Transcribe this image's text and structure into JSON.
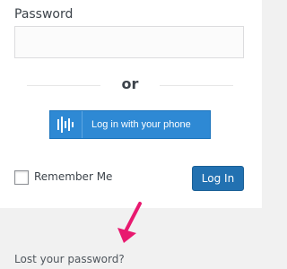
{
  "password": {
    "label": "Password",
    "value": ""
  },
  "divider": {
    "text": "or"
  },
  "phone_login": {
    "label": "Log in with your phone",
    "icon": "phone-bars-icon"
  },
  "remember": {
    "label": "Remember Me",
    "checked": false
  },
  "login_button": {
    "label": "Log In"
  },
  "lost_password": {
    "label": "Lost your password?"
  },
  "colors": {
    "accent": "#2271b1",
    "arrow": "#e8196f",
    "page_bg": "#f1f1f1"
  }
}
